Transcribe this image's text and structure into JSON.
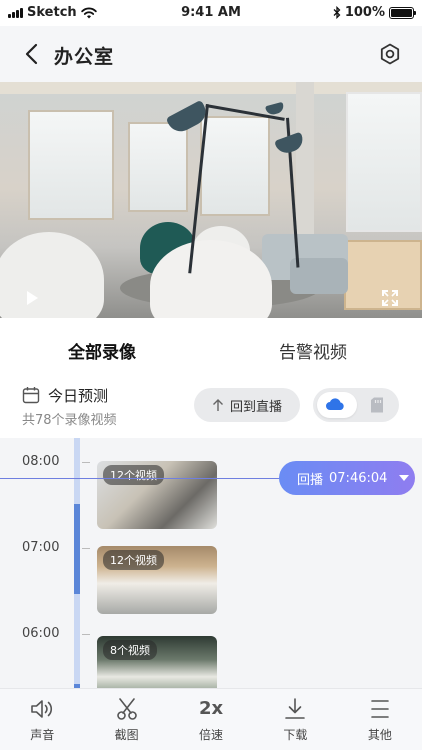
{
  "status_bar": {
    "carrier": "Sketch",
    "time": "9:41 AM",
    "battery": "100%",
    "battery_level": 1.0
  },
  "nav": {
    "title": "办公室"
  },
  "tabs": [
    {
      "label": "全部录像",
      "active": true
    },
    {
      "label": "告警视频",
      "active": false
    }
  ],
  "info": {
    "title": "今日预测",
    "subtitle": "共78个录像视频",
    "live_button": "回到直播",
    "storage": {
      "active": "cloud"
    }
  },
  "timeline": {
    "hours": [
      "08:00",
      "07:00",
      "06:00"
    ],
    "playback_label": "回播",
    "playback_time": "07:46:04",
    "clips": [
      {
        "badge": "12个视频"
      },
      {
        "badge": "12个视频"
      },
      {
        "badge": "8个视频"
      }
    ]
  },
  "toolbar": {
    "items": [
      {
        "label": "声音",
        "icon": "speaker-icon"
      },
      {
        "label": "截图",
        "icon": "scissors-icon"
      },
      {
        "label": "倍速",
        "icon": "speed-icon",
        "glyph": "2x"
      },
      {
        "label": "下载",
        "icon": "download-icon"
      },
      {
        "label": "其他",
        "icon": "menu-icon"
      }
    ]
  },
  "colors": {
    "accent": "#5b86d8",
    "pill_start": "#6a8cf4",
    "pill_end": "#8f7df0",
    "cloud": "#2f74e8"
  }
}
